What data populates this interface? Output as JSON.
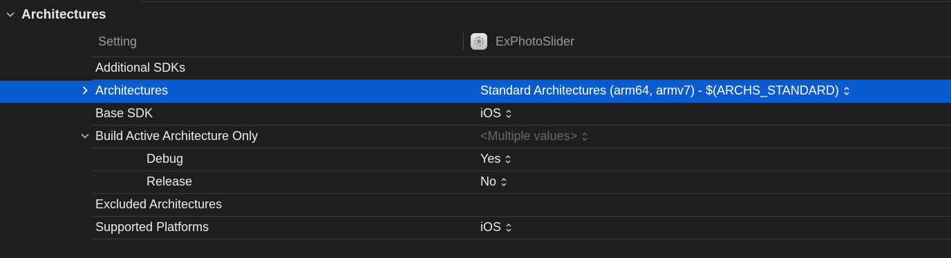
{
  "section": {
    "title": "Architectures"
  },
  "header": {
    "setting_label": "Setting",
    "target_name": "ExPhotoSlider"
  },
  "rows": [
    {
      "label": "Additional SDKs",
      "value": ""
    },
    {
      "label": "Architectures",
      "value": "Standard Architectures (arm64, armv7)  -  $(ARCHS_STANDARD)",
      "selected": true,
      "disclosure": "collapsed"
    },
    {
      "label": "Base SDK",
      "value": "iOS"
    },
    {
      "label": "Build Active Architecture Only",
      "value": "<Multiple values>",
      "disclosure": "expanded"
    },
    {
      "label": "Debug",
      "value": "Yes"
    },
    {
      "label": "Release",
      "value": "No"
    },
    {
      "label": "Excluded Architectures",
      "value": ""
    },
    {
      "label": "Supported Platforms",
      "value": "iOS"
    }
  ],
  "icons": {
    "section_disclosure": "chevron-down-icon",
    "row_collapsed": "chevron-right-icon",
    "row_expanded": "chevron-down-icon",
    "popup_indicator": "up-down-arrows-icon",
    "target": "app-target-icon"
  },
  "colors": {
    "background": "#1e1e1e",
    "selection": "#0b5bd0",
    "separator": "#3a3a3a",
    "dim_text": "#6a6a6a"
  }
}
